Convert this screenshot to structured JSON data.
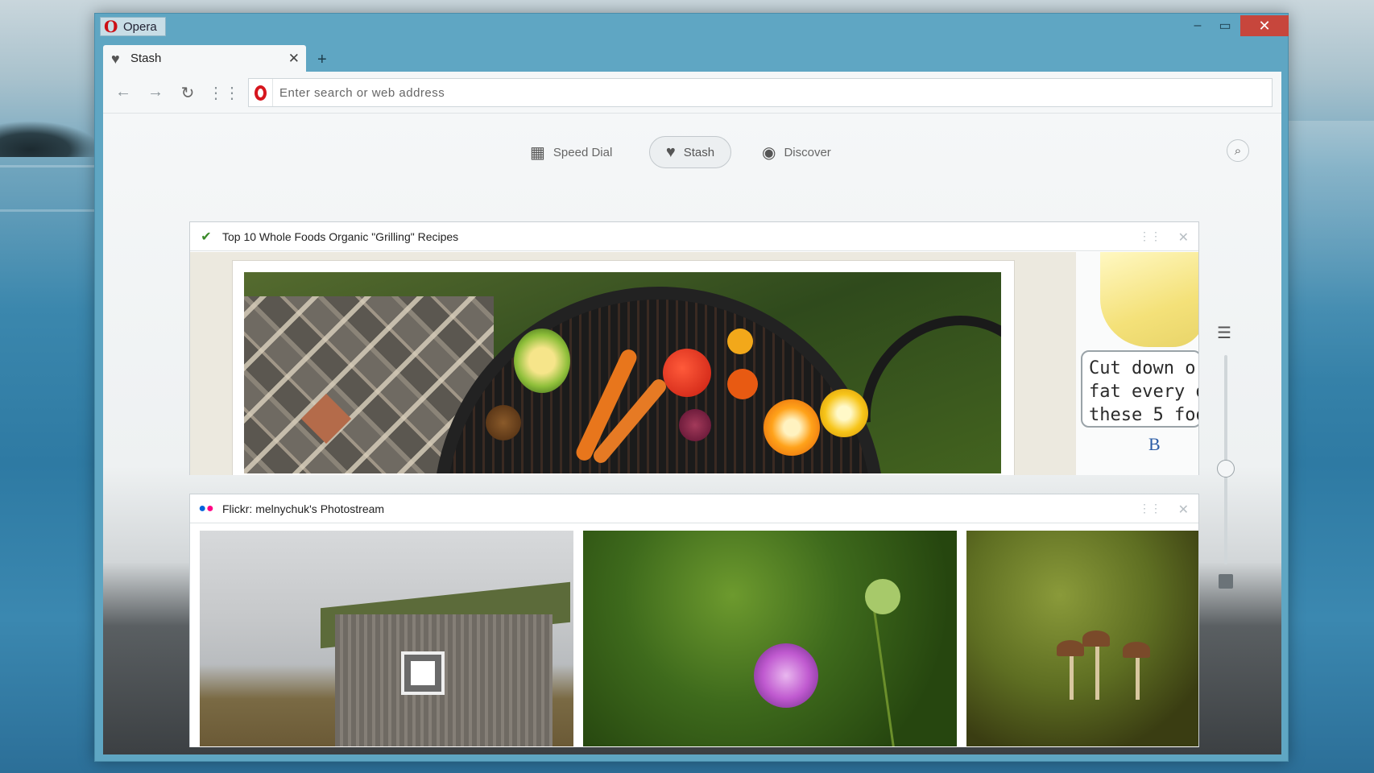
{
  "window": {
    "app_name": "Opera",
    "controls": {
      "minimize": "–",
      "maximize": "▭",
      "close": "✕"
    }
  },
  "tabs": [
    {
      "label": "Stash",
      "icon": "heart-icon",
      "close": "✕"
    }
  ],
  "new_tab_label": "+",
  "toolbar": {
    "address_placeholder": "Enter search or web address"
  },
  "start_nav": {
    "items": [
      {
        "label": "Speed Dial",
        "icon": "grid-icon"
      },
      {
        "label": "Stash",
        "icon": "heart-icon",
        "active": true
      },
      {
        "label": "Discover",
        "icon": "eye-icon"
      }
    ]
  },
  "stash_items": [
    {
      "title": "Top 10 Whole Foods Organic \"Grilling\" Recipes",
      "favicon": "whole-foods-leaf-icon",
      "ad_text": [
        "Cut down o",
        "fat every d",
        "these 5 foo"
      ],
      "ad_logo": "B"
    },
    {
      "title": "Flickr: melnychuk's Photostream",
      "favicon": "flickr-dots-icon"
    }
  ],
  "colors": {
    "window_frame": "#5fa6c3",
    "close_button": "#c7463c",
    "opera_red": "#d6161e",
    "flickr_blue": "#0063dc",
    "flickr_pink": "#ff0084",
    "whole_foods_green": "#3a8a2a"
  }
}
